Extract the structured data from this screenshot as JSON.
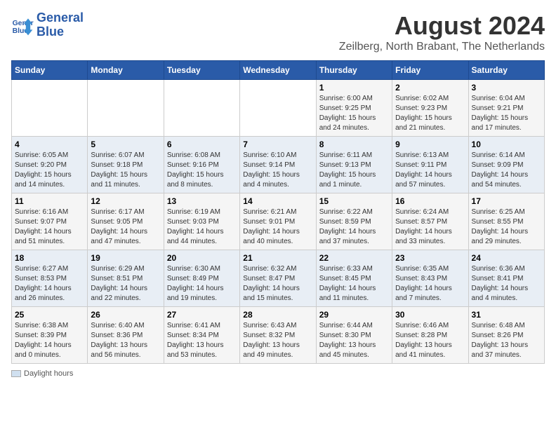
{
  "logo": {
    "line1": "General",
    "line2": "Blue"
  },
  "title": "August 2024",
  "subtitle": "Zeilberg, North Brabant, The Netherlands",
  "days_header": [
    "Sunday",
    "Monday",
    "Tuesday",
    "Wednesday",
    "Thursday",
    "Friday",
    "Saturday"
  ],
  "legend_label": "Daylight hours",
  "weeks": [
    [
      {
        "day": "",
        "info": ""
      },
      {
        "day": "",
        "info": ""
      },
      {
        "day": "",
        "info": ""
      },
      {
        "day": "",
        "info": ""
      },
      {
        "day": "1",
        "info": "Sunrise: 6:00 AM\nSunset: 9:25 PM\nDaylight: 15 hours\nand 24 minutes."
      },
      {
        "day": "2",
        "info": "Sunrise: 6:02 AM\nSunset: 9:23 PM\nDaylight: 15 hours\nand 21 minutes."
      },
      {
        "day": "3",
        "info": "Sunrise: 6:04 AM\nSunset: 9:21 PM\nDaylight: 15 hours\nand 17 minutes."
      }
    ],
    [
      {
        "day": "4",
        "info": "Sunrise: 6:05 AM\nSunset: 9:20 PM\nDaylight: 15 hours\nand 14 minutes."
      },
      {
        "day": "5",
        "info": "Sunrise: 6:07 AM\nSunset: 9:18 PM\nDaylight: 15 hours\nand 11 minutes."
      },
      {
        "day": "6",
        "info": "Sunrise: 6:08 AM\nSunset: 9:16 PM\nDaylight: 15 hours\nand 8 minutes."
      },
      {
        "day": "7",
        "info": "Sunrise: 6:10 AM\nSunset: 9:14 PM\nDaylight: 15 hours\nand 4 minutes."
      },
      {
        "day": "8",
        "info": "Sunrise: 6:11 AM\nSunset: 9:13 PM\nDaylight: 15 hours\nand 1 minute."
      },
      {
        "day": "9",
        "info": "Sunrise: 6:13 AM\nSunset: 9:11 PM\nDaylight: 14 hours\nand 57 minutes."
      },
      {
        "day": "10",
        "info": "Sunrise: 6:14 AM\nSunset: 9:09 PM\nDaylight: 14 hours\nand 54 minutes."
      }
    ],
    [
      {
        "day": "11",
        "info": "Sunrise: 6:16 AM\nSunset: 9:07 PM\nDaylight: 14 hours\nand 51 minutes."
      },
      {
        "day": "12",
        "info": "Sunrise: 6:17 AM\nSunset: 9:05 PM\nDaylight: 14 hours\nand 47 minutes."
      },
      {
        "day": "13",
        "info": "Sunrise: 6:19 AM\nSunset: 9:03 PM\nDaylight: 14 hours\nand 44 minutes."
      },
      {
        "day": "14",
        "info": "Sunrise: 6:21 AM\nSunset: 9:01 PM\nDaylight: 14 hours\nand 40 minutes."
      },
      {
        "day": "15",
        "info": "Sunrise: 6:22 AM\nSunset: 8:59 PM\nDaylight: 14 hours\nand 37 minutes."
      },
      {
        "day": "16",
        "info": "Sunrise: 6:24 AM\nSunset: 8:57 PM\nDaylight: 14 hours\nand 33 minutes."
      },
      {
        "day": "17",
        "info": "Sunrise: 6:25 AM\nSunset: 8:55 PM\nDaylight: 14 hours\nand 29 minutes."
      }
    ],
    [
      {
        "day": "18",
        "info": "Sunrise: 6:27 AM\nSunset: 8:53 PM\nDaylight: 14 hours\nand 26 minutes."
      },
      {
        "day": "19",
        "info": "Sunrise: 6:29 AM\nSunset: 8:51 PM\nDaylight: 14 hours\nand 22 minutes."
      },
      {
        "day": "20",
        "info": "Sunrise: 6:30 AM\nSunset: 8:49 PM\nDaylight: 14 hours\nand 19 minutes."
      },
      {
        "day": "21",
        "info": "Sunrise: 6:32 AM\nSunset: 8:47 PM\nDaylight: 14 hours\nand 15 minutes."
      },
      {
        "day": "22",
        "info": "Sunrise: 6:33 AM\nSunset: 8:45 PM\nDaylight: 14 hours\nand 11 minutes."
      },
      {
        "day": "23",
        "info": "Sunrise: 6:35 AM\nSunset: 8:43 PM\nDaylight: 14 hours\nand 7 minutes."
      },
      {
        "day": "24",
        "info": "Sunrise: 6:36 AM\nSunset: 8:41 PM\nDaylight: 14 hours\nand 4 minutes."
      }
    ],
    [
      {
        "day": "25",
        "info": "Sunrise: 6:38 AM\nSunset: 8:39 PM\nDaylight: 14 hours\nand 0 minutes."
      },
      {
        "day": "26",
        "info": "Sunrise: 6:40 AM\nSunset: 8:36 PM\nDaylight: 13 hours\nand 56 minutes."
      },
      {
        "day": "27",
        "info": "Sunrise: 6:41 AM\nSunset: 8:34 PM\nDaylight: 13 hours\nand 53 minutes."
      },
      {
        "day": "28",
        "info": "Sunrise: 6:43 AM\nSunset: 8:32 PM\nDaylight: 13 hours\nand 49 minutes."
      },
      {
        "day": "29",
        "info": "Sunrise: 6:44 AM\nSunset: 8:30 PM\nDaylight: 13 hours\nand 45 minutes."
      },
      {
        "day": "30",
        "info": "Sunrise: 6:46 AM\nSunset: 8:28 PM\nDaylight: 13 hours\nand 41 minutes."
      },
      {
        "day": "31",
        "info": "Sunrise: 6:48 AM\nSunset: 8:26 PM\nDaylight: 13 hours\nand 37 minutes."
      }
    ]
  ]
}
